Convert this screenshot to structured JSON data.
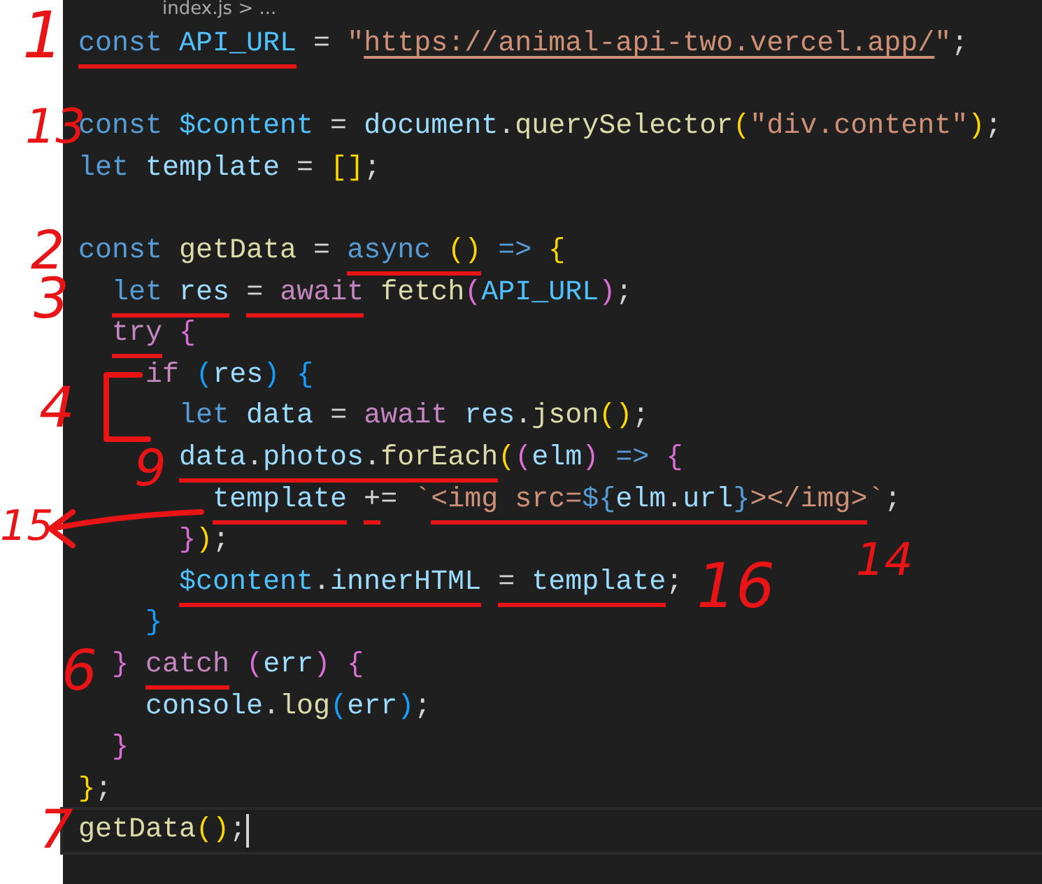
{
  "breadcrumb": "index.js > ...",
  "lines": [
    {
      "active": false,
      "tokens": [
        {
          "text": "const ",
          "kind": "keyword",
          "underlined": true
        },
        {
          "text": "API_URL",
          "kind": "constant",
          "underlined": true
        },
        {
          "text": " = ",
          "kind": "plain"
        },
        {
          "text": "\"",
          "kind": "string"
        },
        {
          "text": "https://animal-api-two.vercel.app/",
          "kind": "link"
        },
        {
          "text": "\"",
          "kind": "string"
        },
        {
          "text": ";",
          "kind": "plain"
        }
      ]
    },
    {
      "active": false
    },
    {
      "active": false,
      "tokens": [
        {
          "text": "const ",
          "kind": "keyword"
        },
        {
          "text": "$content",
          "kind": "constant"
        },
        {
          "text": " = ",
          "kind": "plain"
        },
        {
          "text": "document",
          "kind": "variable"
        },
        {
          "text": ".",
          "kind": "plain"
        },
        {
          "text": "querySelector",
          "kind": "function"
        },
        {
          "text": "(",
          "kind": "bracket1"
        },
        {
          "text": "\"div.content\"",
          "kind": "string"
        },
        {
          "text": ")",
          "kind": "bracket1"
        },
        {
          "text": ";",
          "kind": "plain"
        }
      ]
    },
    {
      "active": false,
      "tokens": [
        {
          "text": "let ",
          "kind": "keyword"
        },
        {
          "text": "template",
          "kind": "variable"
        },
        {
          "text": " = ",
          "kind": "plain"
        },
        {
          "text": "[]",
          "kind": "bracket1"
        },
        {
          "text": ";",
          "kind": "plain"
        }
      ]
    },
    {
      "active": false
    },
    {
      "active": false,
      "tokens": [
        {
          "text": "const ",
          "kind": "keyword"
        },
        {
          "text": "getData",
          "kind": "function"
        },
        {
          "text": " = ",
          "kind": "plain"
        },
        {
          "text": "async ",
          "kind": "keyword",
          "underlined": true
        },
        {
          "text": "()",
          "kind": "bracket1",
          "underlined": true
        },
        {
          "text": " =>",
          "kind": "keyword"
        },
        {
          "text": " {",
          "kind": "bracket1"
        }
      ]
    },
    {
      "active": false,
      "tokens": [
        {
          "text": "  let ",
          "kind": "keyword",
          "underlined": true
        },
        {
          "text": "res",
          "kind": "variable",
          "underlined": true
        },
        {
          "text": " = ",
          "kind": "plain",
          "underlined": true
        },
        {
          "text": "await",
          "kind": "control",
          "underlined": true
        },
        {
          "text": " fetch",
          "kind": "function"
        },
        {
          "text": "(",
          "kind": "bracket2"
        },
        {
          "text": "API_URL",
          "kind": "constant"
        },
        {
          "text": ")",
          "kind": "bracket2"
        },
        {
          "text": ";",
          "kind": "plain"
        }
      ]
    },
    {
      "active": false,
      "tokens": [
        {
          "text": "  try",
          "kind": "control",
          "underlined": true
        },
        {
          "text": " {",
          "kind": "bracket2"
        }
      ]
    },
    {
      "active": false,
      "tokens": [
        {
          "text": "    if",
          "kind": "control"
        },
        {
          "text": " (",
          "kind": "bracket3"
        },
        {
          "text": "res",
          "kind": "variable"
        },
        {
          "text": ")",
          "kind": "bracket3"
        },
        {
          "text": " {",
          "kind": "bracket3"
        }
      ]
    },
    {
      "active": false,
      "tokens": [
        {
          "text": "      let ",
          "kind": "keyword"
        },
        {
          "text": "data",
          "kind": "variable"
        },
        {
          "text": " = ",
          "kind": "plain"
        },
        {
          "text": "await",
          "kind": "control"
        },
        {
          "text": " res",
          "kind": "variable"
        },
        {
          "text": ".",
          "kind": "plain"
        },
        {
          "text": "json",
          "kind": "function"
        },
        {
          "text": "()",
          "kind": "bracket1"
        },
        {
          "text": ";",
          "kind": "plain"
        }
      ]
    },
    {
      "active": false,
      "tokens": [
        {
          "text": "      data",
          "kind": "variable",
          "underlined": true
        },
        {
          "text": ".",
          "kind": "plain",
          "underlined": true
        },
        {
          "text": "photos",
          "kind": "variable",
          "underlined": true
        },
        {
          "text": ".",
          "kind": "plain",
          "underlined": true
        },
        {
          "text": "forEach",
          "kind": "function",
          "underlined": true
        },
        {
          "text": "(",
          "kind": "bracket1"
        },
        {
          "text": "(",
          "kind": "bracket2"
        },
        {
          "text": "elm",
          "kind": "variable"
        },
        {
          "text": ")",
          "kind": "bracket2"
        },
        {
          "text": " =>",
          "kind": "keyword"
        },
        {
          "text": " {",
          "kind": "bracket2"
        }
      ]
    },
    {
      "active": false,
      "tokens": [
        {
          "text": "        template",
          "kind": "variable",
          "underlined": true
        },
        {
          "text": " +",
          "kind": "plain",
          "underlined": true
        },
        {
          "text": "= ",
          "kind": "plain"
        },
        {
          "text": "`",
          "kind": "string"
        },
        {
          "text": "<img src=",
          "kind": "string",
          "underlined": true
        },
        {
          "text": "${",
          "kind": "keyword",
          "underlined": true
        },
        {
          "text": "elm",
          "kind": "variable",
          "underlined": true
        },
        {
          "text": ".",
          "kind": "plain",
          "underlined": true
        },
        {
          "text": "url",
          "kind": "variable",
          "underlined": true
        },
        {
          "text": "}",
          "kind": "keyword",
          "underlined": true
        },
        {
          "text": "></img>",
          "kind": "string",
          "underlined": true
        },
        {
          "text": "`",
          "kind": "string"
        },
        {
          "text": ";",
          "kind": "plain"
        }
      ]
    },
    {
      "active": false,
      "tokens": [
        {
          "text": "      }",
          "kind": "bracket2"
        },
        {
          "text": ")",
          "kind": "bracket1"
        },
        {
          "text": ";",
          "kind": "plain"
        }
      ]
    },
    {
      "active": false,
      "tokens": [
        {
          "text": "      $content",
          "kind": "constant",
          "underlined": true
        },
        {
          "text": ".",
          "kind": "plain",
          "underlined": true
        },
        {
          "text": "innerHTML",
          "kind": "variable",
          "underlined": true
        },
        {
          "text": " = ",
          "kind": "plain",
          "underlined": true
        },
        {
          "text": "template",
          "kind": "variable",
          "underlined": true
        },
        {
          "text": ";",
          "kind": "plain"
        }
      ]
    },
    {
      "active": false,
      "tokens": [
        {
          "text": "    }",
          "kind": "bracket3"
        }
      ]
    },
    {
      "active": false,
      "tokens": [
        {
          "text": "  }",
          "kind": "bracket2"
        },
        {
          "text": " catch",
          "kind": "control",
          "underlined": true
        },
        {
          "text": " (",
          "kind": "bracket2"
        },
        {
          "text": "err",
          "kind": "variable"
        },
        {
          "text": ")",
          "kind": "bracket2"
        },
        {
          "text": " {",
          "kind": "bracket2"
        }
      ]
    },
    {
      "active": false,
      "tokens": [
        {
          "text": "    console",
          "kind": "variable"
        },
        {
          "text": ".",
          "kind": "plain"
        },
        {
          "text": "log",
          "kind": "function"
        },
        {
          "text": "(",
          "kind": "bracket3"
        },
        {
          "text": "err",
          "kind": "variable"
        },
        {
          "text": ")",
          "kind": "bracket3"
        },
        {
          "text": ";",
          "kind": "plain"
        }
      ]
    },
    {
      "active": false,
      "tokens": [
        {
          "text": "  }",
          "kind": "bracket2"
        }
      ]
    },
    {
      "active": false,
      "tokens": [
        {
          "text": "}",
          "kind": "bracket1"
        },
        {
          "text": ";",
          "kind": "plain"
        }
      ]
    },
    {
      "active": true,
      "tokens": [
        {
          "text": "getData",
          "kind": "function"
        },
        {
          "text": "()",
          "kind": "bracket1"
        },
        {
          "text": ";",
          "kind": "plain"
        }
      ]
    }
  ],
  "annotations": [
    {
      "text": "1"
    },
    {
      "text": "13"
    },
    {
      "text": "2"
    },
    {
      "text": "3"
    },
    {
      "text": "4"
    },
    {
      "text": "9"
    },
    {
      "text": "15"
    },
    {
      "text": "16"
    },
    {
      "text": "14"
    },
    {
      "text": "6"
    },
    {
      "text": "7"
    }
  ]
}
